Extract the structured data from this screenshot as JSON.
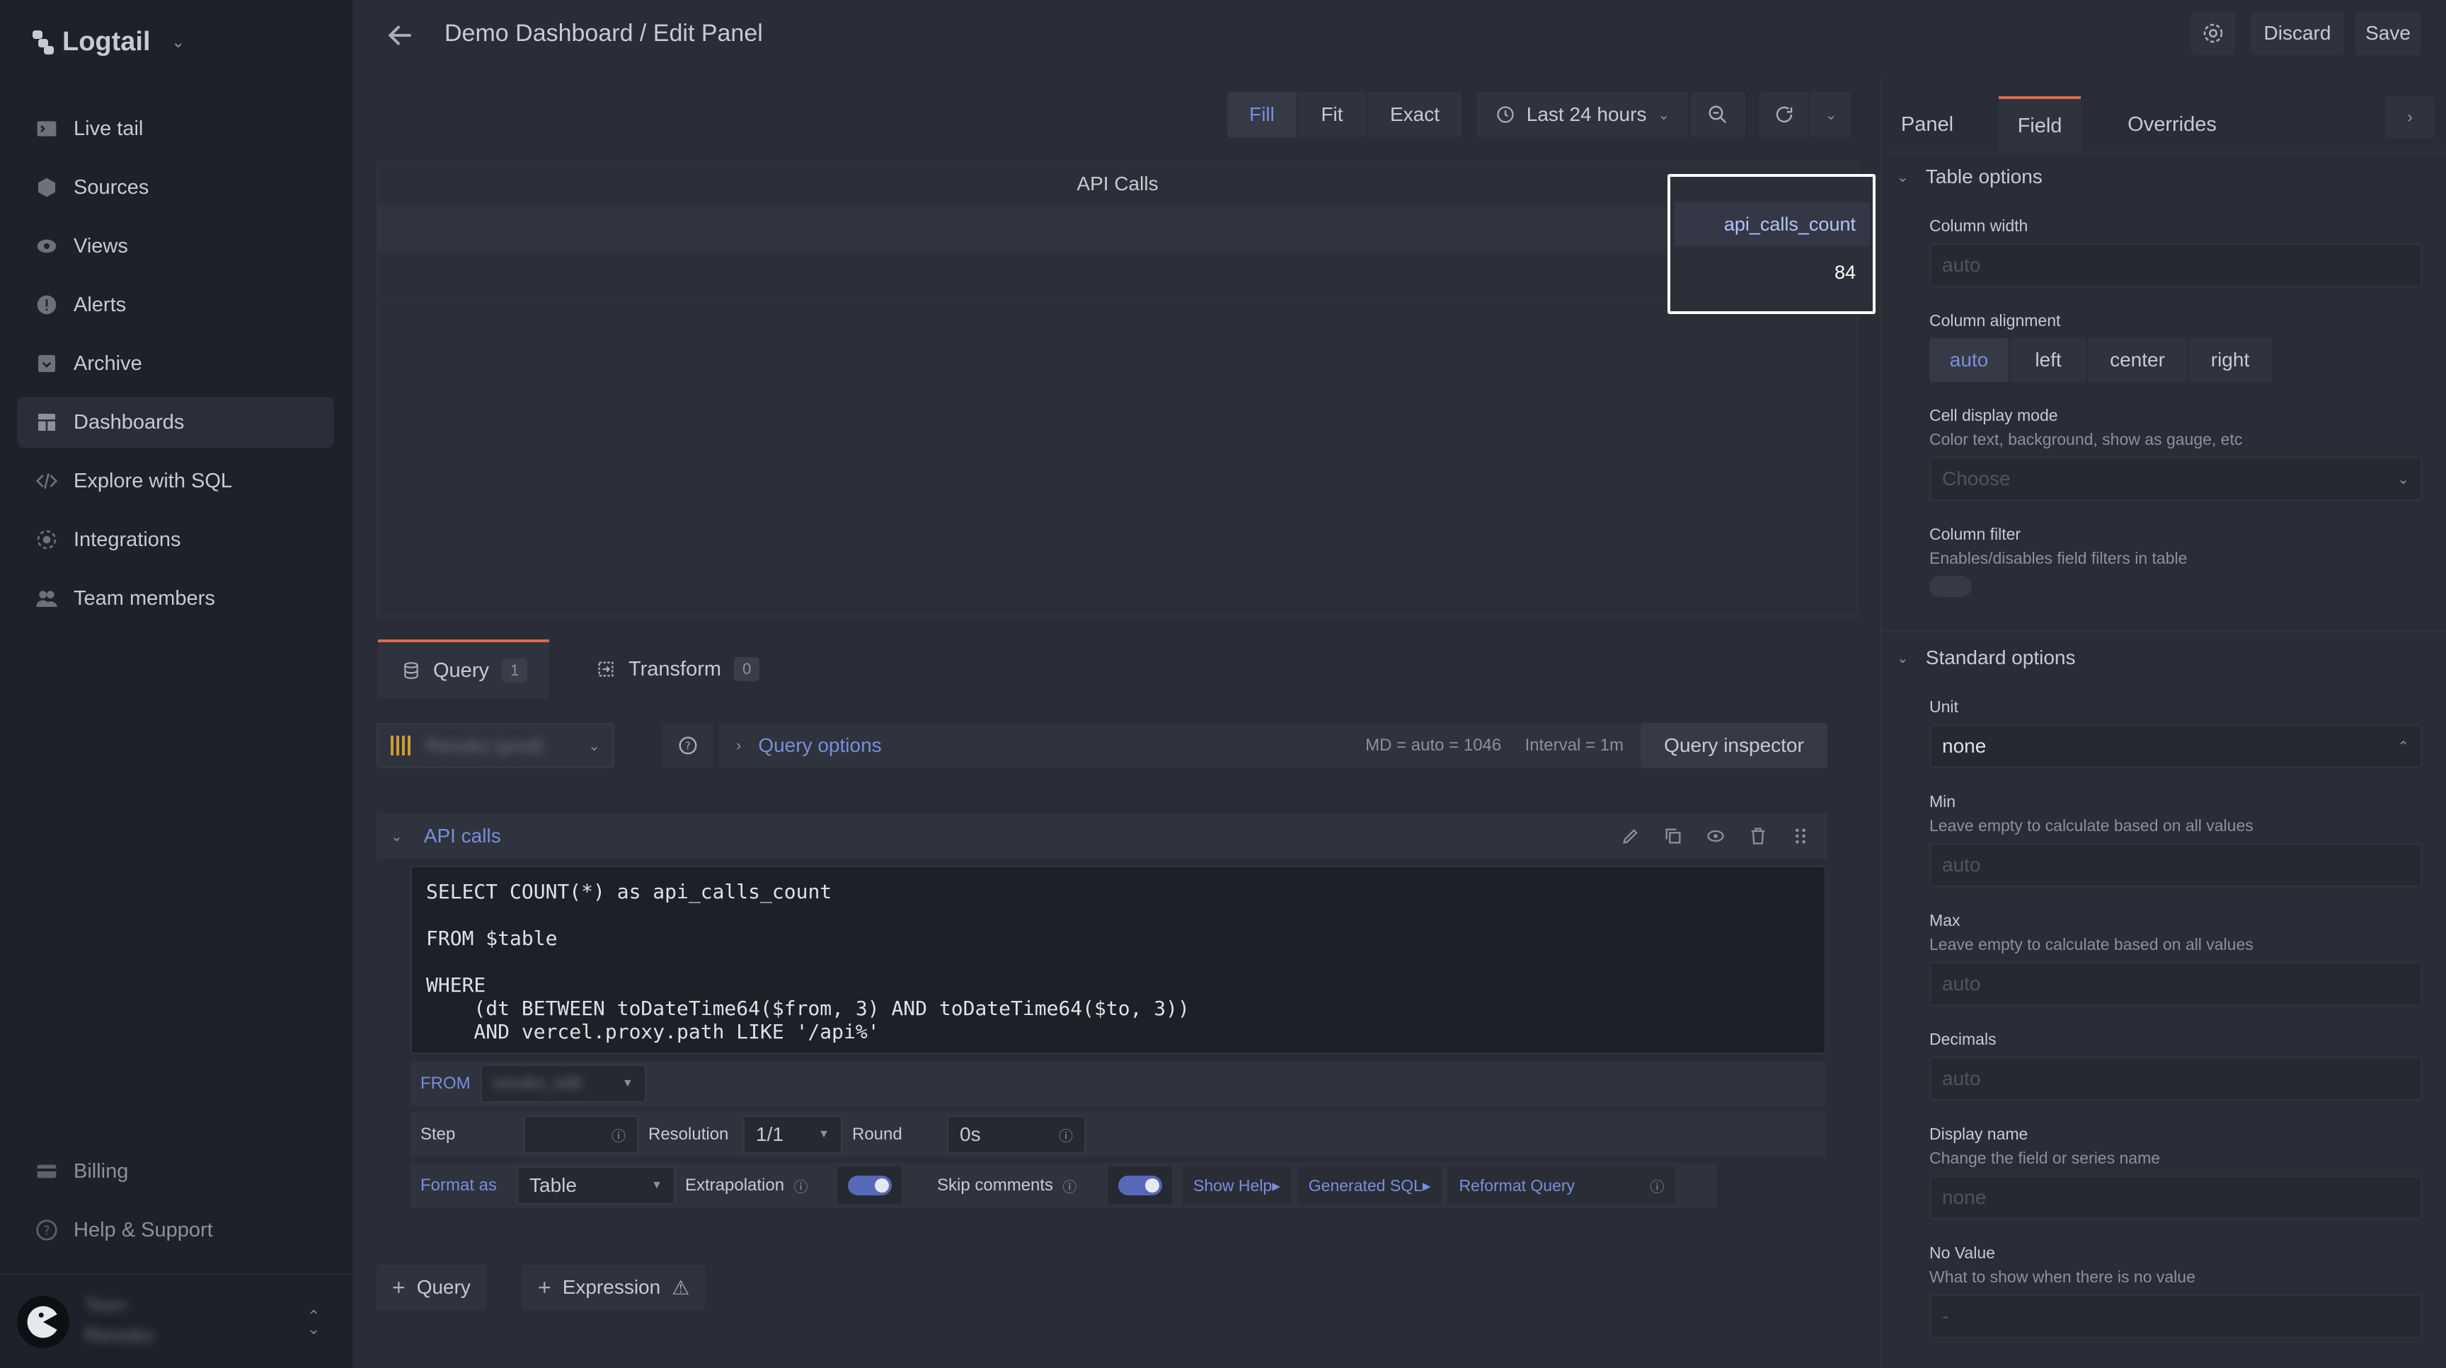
{
  "app": {
    "name": "Logtail"
  },
  "sidebar": {
    "items": [
      {
        "label": "Live tail",
        "icon": "terminal-icon"
      },
      {
        "label": "Sources",
        "icon": "cube-icon"
      },
      {
        "label": "Views",
        "icon": "eye-icon"
      },
      {
        "label": "Alerts",
        "icon": "alert-icon"
      },
      {
        "label": "Archive",
        "icon": "archive-icon"
      },
      {
        "label": "Dashboards",
        "icon": "dashboard-icon"
      },
      {
        "label": "Explore with SQL",
        "icon": "code-icon"
      },
      {
        "label": "Integrations",
        "icon": "integrations-icon"
      },
      {
        "label": "Team members",
        "icon": "team-icon"
      }
    ],
    "bottom": [
      {
        "label": "Billing",
        "icon": "card-icon"
      },
      {
        "label": "Help & Support",
        "icon": "help-icon"
      }
    ],
    "user": {
      "team_label": "Team",
      "team_name": "Renoko"
    }
  },
  "header": {
    "title": "Demo Dashboard / Edit Panel",
    "discard": "Discard",
    "save": "Save"
  },
  "toolbar": {
    "fill": "Fill",
    "fit": "Fit",
    "exact": "Exact",
    "time_range": "Last 24 hours"
  },
  "preview": {
    "title": "API Calls",
    "column": "api_calls_count",
    "value": "84"
  },
  "query_tabs": [
    {
      "label": "Query",
      "count": "1"
    },
    {
      "label": "Transform",
      "count": "0"
    }
  ],
  "query_bar": {
    "datasource": "Renoko (prod)",
    "options_label": "Query options",
    "md": "MD = auto = 1046",
    "interval": "Interval = 1m",
    "inspector": "Query inspector"
  },
  "query": {
    "name": "API calls",
    "sql": "SELECT COUNT(*) as api_calls_count\n\nFROM $table\n\nWHERE\n    (dt BETWEEN toDateTime64($from, 3) AND toDateTime64($to, 3))\n    AND vercel.proxy.path LIKE '/api%'",
    "from_label": "FROM",
    "from_value": "renoko_edit",
    "step_label": "Step",
    "resolution_label": "Resolution",
    "resolution_value": "1/1",
    "round_label": "Round",
    "round_value": "0s",
    "format_label": "Format as",
    "format_value": "Table",
    "extrapolation_label": "Extrapolation",
    "skip_comments_label": "Skip comments",
    "show_help": "Show Help▸",
    "generated_sql": "Generated SQL▸",
    "reformat": "Reformat Query"
  },
  "add_buttons": {
    "query": "Query",
    "expression": "Expression"
  },
  "options_pane": {
    "tabs": [
      "Panel",
      "Field",
      "Overrides"
    ],
    "table_options": "Table options",
    "column_width": {
      "label": "Column width",
      "placeholder": "auto"
    },
    "column_alignment": {
      "label": "Column alignment",
      "options": [
        "auto",
        "left",
        "center",
        "right"
      ]
    },
    "cell_display": {
      "label": "Cell display mode",
      "desc": "Color text, background, show as gauge, etc",
      "placeholder": "Choose"
    },
    "column_filter": {
      "label": "Column filter",
      "desc": "Enables/disables field filters in table"
    },
    "standard_options": "Standard options",
    "unit": {
      "label": "Unit",
      "value": "none"
    },
    "min": {
      "label": "Min",
      "desc": "Leave empty to calculate based on all values",
      "placeholder": "auto"
    },
    "max": {
      "label": "Max",
      "desc": "Leave empty to calculate based on all values",
      "placeholder": "auto"
    },
    "decimals": {
      "label": "Decimals",
      "placeholder": "auto"
    },
    "display_name": {
      "label": "Display name",
      "desc": "Change the field or series name",
      "placeholder": "none"
    },
    "no_value": {
      "label": "No Value",
      "desc": "What to show when there is no value",
      "placeholder": "-"
    }
  },
  "colors": {
    "accent": "#7a8ed9",
    "tab_active": "#e06a4a",
    "highlight": "#ffffff"
  }
}
